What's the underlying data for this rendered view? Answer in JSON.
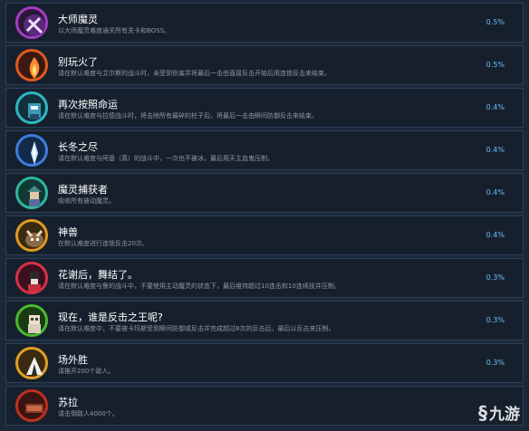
{
  "achievements": [
    {
      "title": "大师魔灵",
      "desc": "以大师魔灵难度通关所有关卡和BOSS。",
      "percent": "0.5%",
      "icon": "master-spirit-icon",
      "ring": "#a83ac8"
    },
    {
      "title": "别玩火了",
      "desc": "请在默认难度与艾尔斯的战斗时，未受到伤害并将最后一击由直接反击开始后用连锁反击来结束。",
      "percent": "0.5%",
      "icon": "fire-spirit-icon",
      "ring": "#e05a20"
    },
    {
      "title": "再次按照命运",
      "desc": "请在默认难度与拉德战斗时，将击除所有最碎的柱子后，将最后一击由瞬间防御反击来结束。",
      "percent": "0.4%",
      "icon": "fate-spirit-icon",
      "ring": "#2fb6c4"
    },
    {
      "title": "长冬之尽",
      "desc": "请在默认难度与阿基（真）的战斗中，一次也不被冰，最后用天主血鬼压制。",
      "percent": "0.4%",
      "icon": "ice-spirit-icon",
      "ring": "#3a7ee0"
    },
    {
      "title": "魔灵捕获者",
      "desc": "吸收所有被动魔灵。",
      "percent": "0.4%",
      "icon": "spirit-catcher-icon",
      "ring": "#2fb6a0"
    },
    {
      "title": "神兽",
      "desc": "在默认难度进行连锁反击20次。",
      "percent": "0.4%",
      "icon": "beast-icon",
      "ring": "#e09a20"
    },
    {
      "title": "花谢后，舞结了。",
      "desc": "请在默认难度与鲁的战斗中，不要使用主动魔灵的状态下，最后维持超过10连击和10连续技并压制。",
      "percent": "0.3%",
      "icon": "flower-dance-icon",
      "ring": "#d8304a"
    },
    {
      "title": "现在，谁是反击之王呢?",
      "desc": "请在默认难度中，不要被卡玛斯受到瞬间防御或反击并完成超过8次的反击后，最后以反击来压制。",
      "percent": "0.3%",
      "icon": "counter-king-icon",
      "ring": "#4ab830"
    },
    {
      "title": "场外胜",
      "desc": "请推开200个敌人。",
      "percent": "0.3%",
      "icon": "ring-out-icon",
      "ring": "#e0a020"
    },
    {
      "title": "苏拉",
      "desc": "请击倒敌人4000个。",
      "percent": "",
      "icon": "sura-icon",
      "ring": "#c03020"
    }
  ],
  "watermark": {
    "mark": "§",
    "text": "九游"
  }
}
